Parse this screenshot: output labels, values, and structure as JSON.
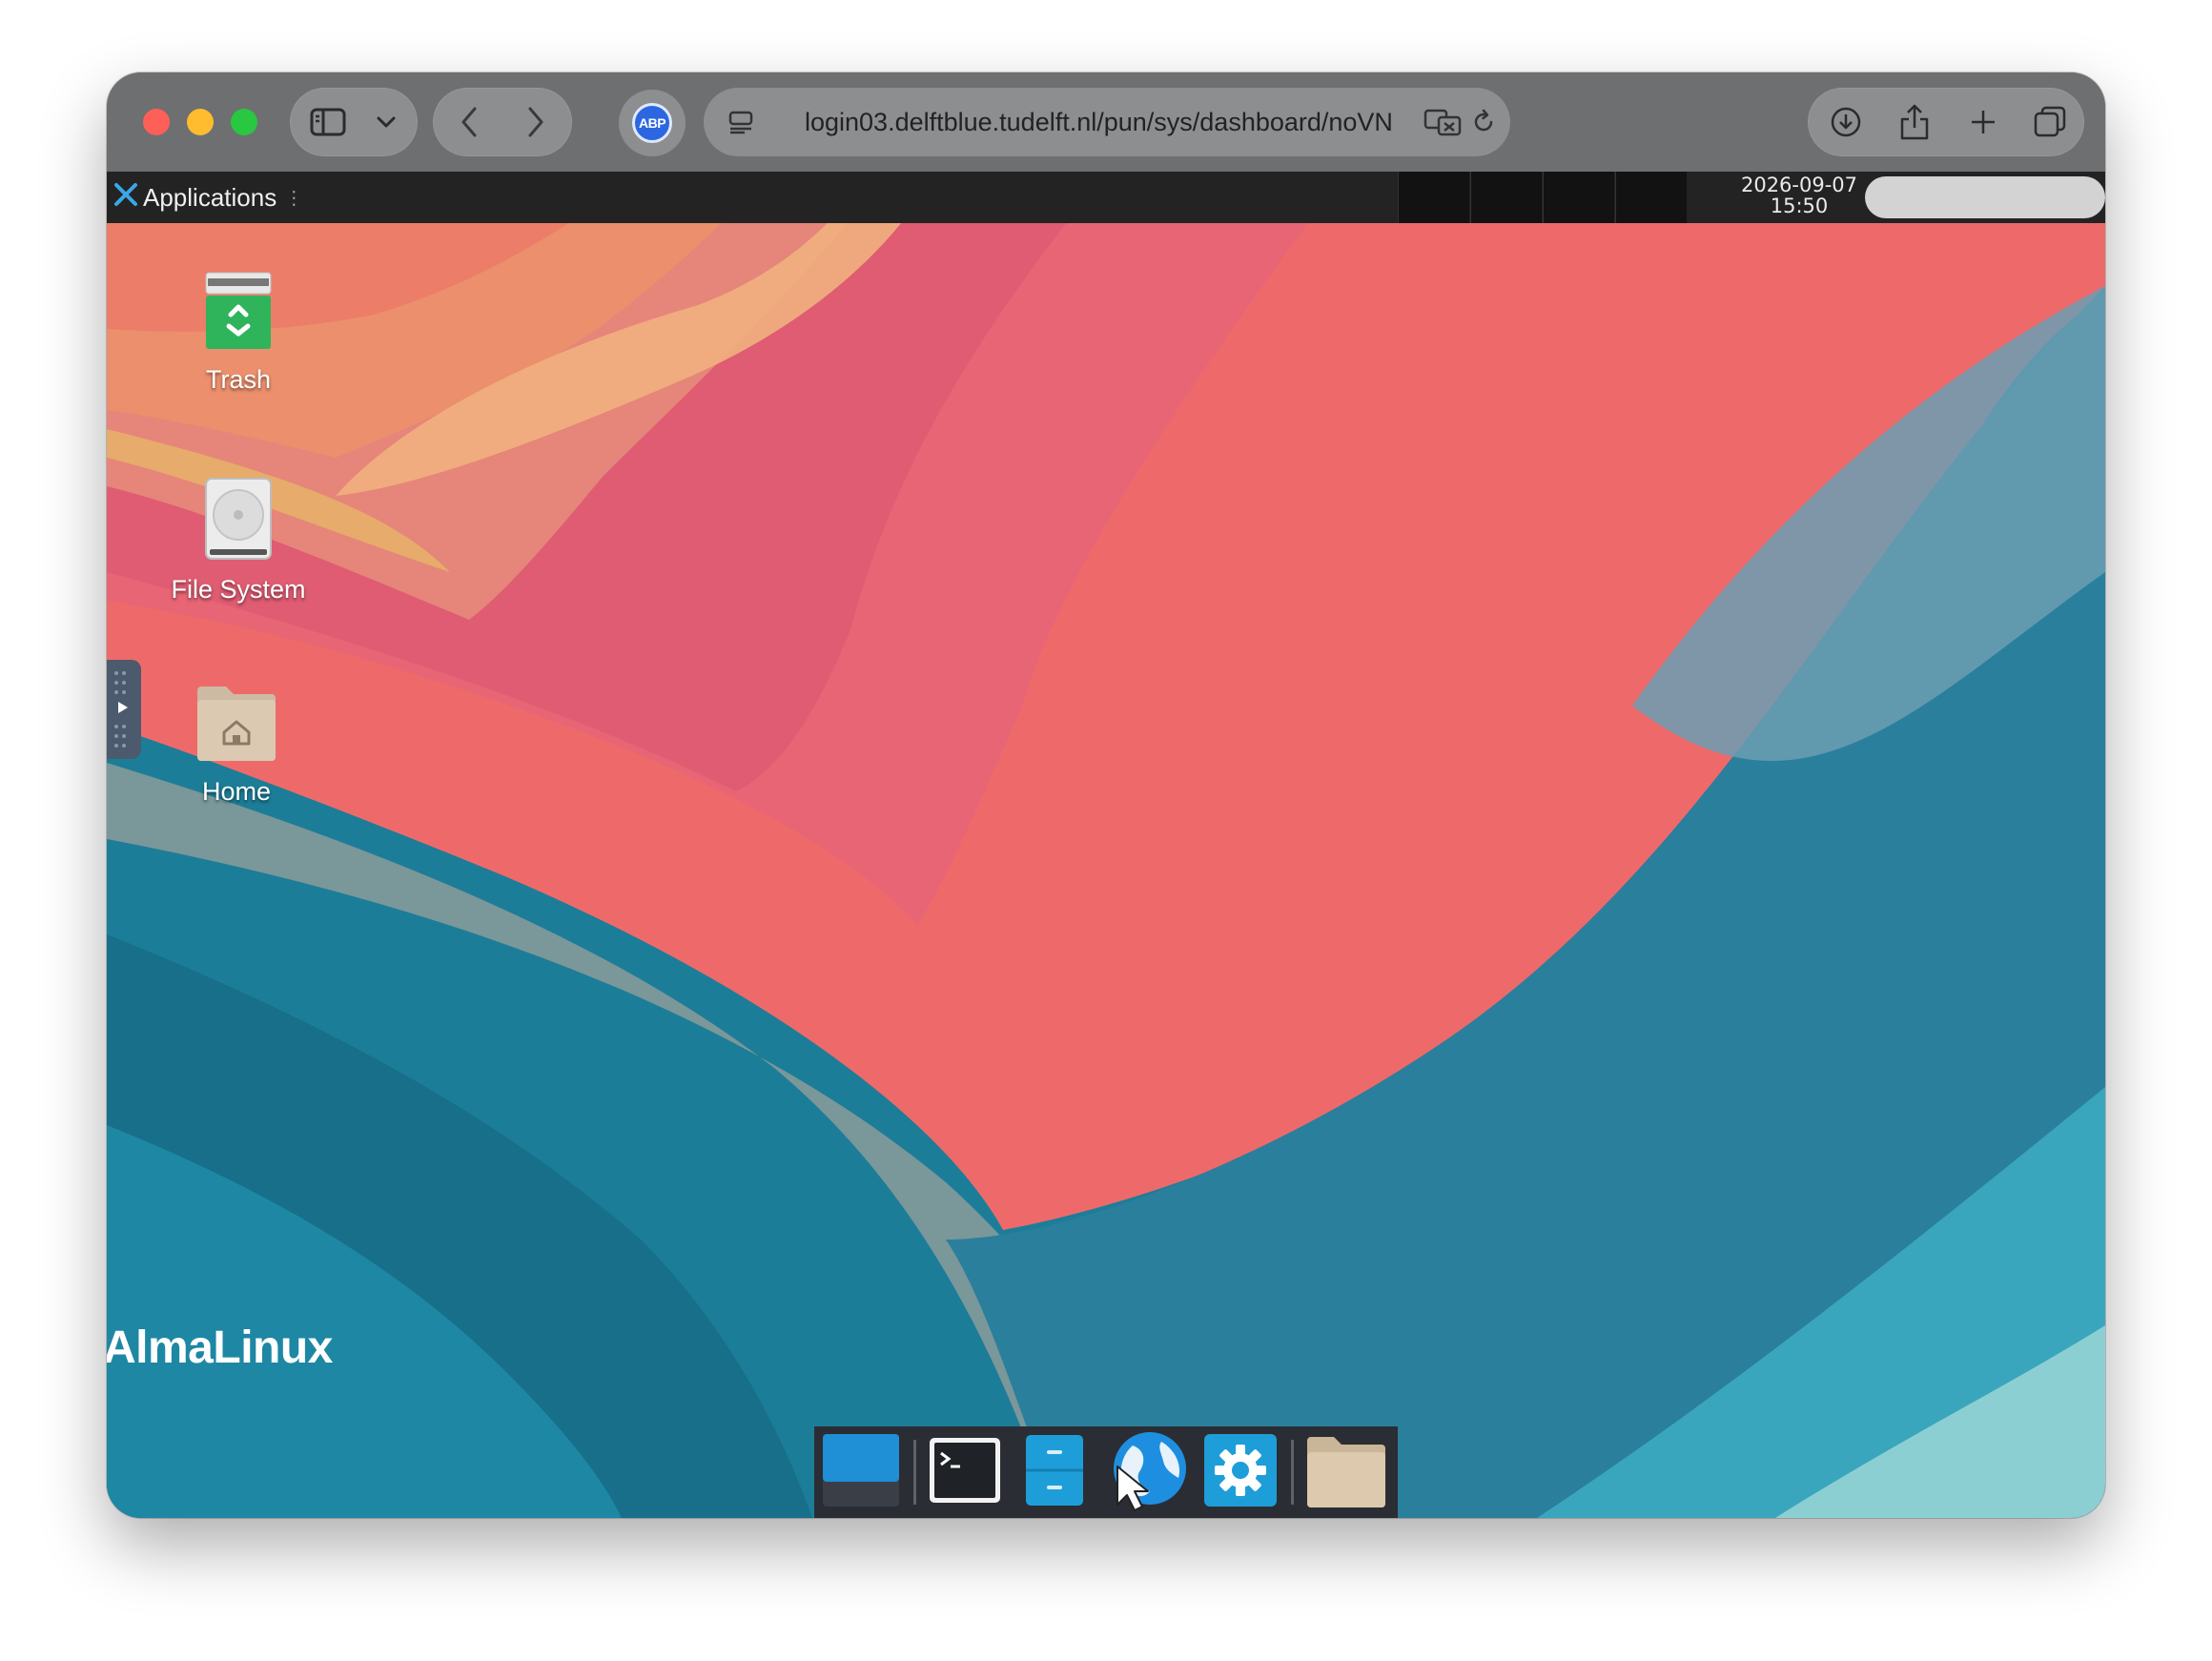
{
  "browser": {
    "url": "login03.delftblue.tudelft.nl/pun/sys/dashboard/noVN",
    "adblock_label": "ABP",
    "icons": [
      "sidebar-icon",
      "chevron-down-icon",
      "back-icon",
      "forward-icon",
      "page-menu-icon",
      "translate-icon",
      "reload-icon",
      "download-icon",
      "share-icon",
      "new-tab-icon",
      "tab-overview-icon"
    ]
  },
  "remote_desktop": {
    "panel": {
      "applications_label": "Applications",
      "date": "2026-09-07",
      "time": "15:50"
    },
    "desktop_icons": [
      {
        "label": "Trash",
        "icon": "trash-icon"
      },
      {
        "label": "File System",
        "icon": "drive-icon"
      },
      {
        "label": "Home",
        "icon": "home-folder-icon"
      }
    ],
    "brand": "AlmaLinux",
    "dock": [
      "show-desktop-icon",
      "terminal-icon",
      "file-manager-icon",
      "web-browser-icon",
      "settings-icon",
      "folder-icon"
    ]
  },
  "colors": {
    "accent_blue": "#2c67e0",
    "wallpaper_coral": "#ee6a6a",
    "wallpaper_teal": "#1c7d98"
  }
}
